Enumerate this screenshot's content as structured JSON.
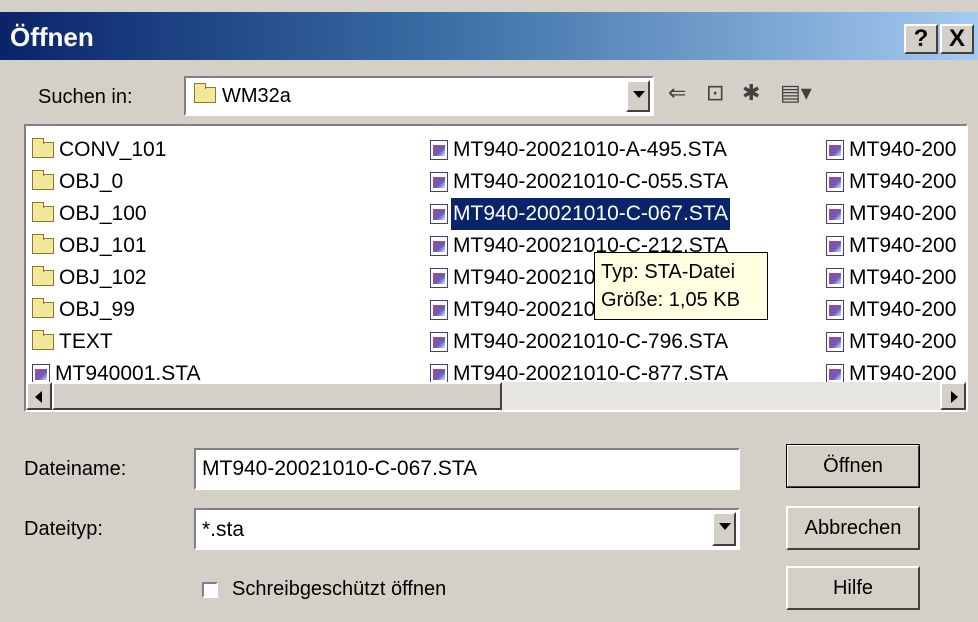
{
  "window": {
    "title": "Öffnen",
    "help_glyph": "?",
    "close_glyph": "X"
  },
  "lookin": {
    "label": "Suchen in:",
    "value": "WM32a"
  },
  "toolbar": {
    "back_glyph": "⇐",
    "up_glyph": "⊡",
    "new_folder_glyph": "✱",
    "view_glyph": "▤▾"
  },
  "files": {
    "col1": [
      {
        "name": "CONV_101",
        "type": "folder"
      },
      {
        "name": "OBJ_0",
        "type": "folder"
      },
      {
        "name": "OBJ_100",
        "type": "folder"
      },
      {
        "name": "OBJ_101",
        "type": "folder"
      },
      {
        "name": "OBJ_102",
        "type": "folder"
      },
      {
        "name": "OBJ_99",
        "type": "folder"
      },
      {
        "name": "TEXT",
        "type": "folder"
      },
      {
        "name": "MT940001.STA",
        "type": "file"
      }
    ],
    "col2": [
      {
        "name": "MT940-20021010-A-495.STA",
        "type": "file"
      },
      {
        "name": "MT940-20021010-C-055.STA",
        "type": "file"
      },
      {
        "name": "MT940-20021010-C-067.STA",
        "type": "file",
        "selected": true
      },
      {
        "name": "MT940-20021010-C-212.STA",
        "type": "file"
      },
      {
        "name": "MT940-20021010-C-305.STA",
        "type": "file"
      },
      {
        "name": "MT940-20021010-C-580.STA",
        "type": "file"
      },
      {
        "name": "MT940-20021010-C-796.STA",
        "type": "file"
      },
      {
        "name": "MT940-20021010-C-877.STA",
        "type": "file"
      }
    ],
    "col3": [
      {
        "name": "MT940-200",
        "type": "file"
      },
      {
        "name": "MT940-200",
        "type": "file"
      },
      {
        "name": "MT940-200",
        "type": "file"
      },
      {
        "name": "MT940-200",
        "type": "file"
      },
      {
        "name": "MT940-200",
        "type": "file"
      },
      {
        "name": "MT940-200",
        "type": "file"
      },
      {
        "name": "MT940-200",
        "type": "file"
      },
      {
        "name": "MT940-200",
        "type": "file"
      }
    ]
  },
  "tooltip": {
    "line1": "Typ: STA-Datei",
    "line2": "Größe: 1,05 KB"
  },
  "filename": {
    "label": "Dateiname:",
    "value": "MT940-20021010-C-067.STA"
  },
  "filetype": {
    "label": "Dateityp:",
    "value": "*.sta"
  },
  "readonly": {
    "label": "Schreibgeschützt öffnen",
    "checked": false
  },
  "buttons": {
    "open": "Öffnen",
    "cancel": "Abbrechen",
    "help": "Hilfe"
  },
  "colors": {
    "title_start": "#0a246a",
    "title_end": "#a6caf0",
    "selection": "#0a246a",
    "tooltip_bg": "#ffffe1",
    "face": "#d4d0c8"
  }
}
